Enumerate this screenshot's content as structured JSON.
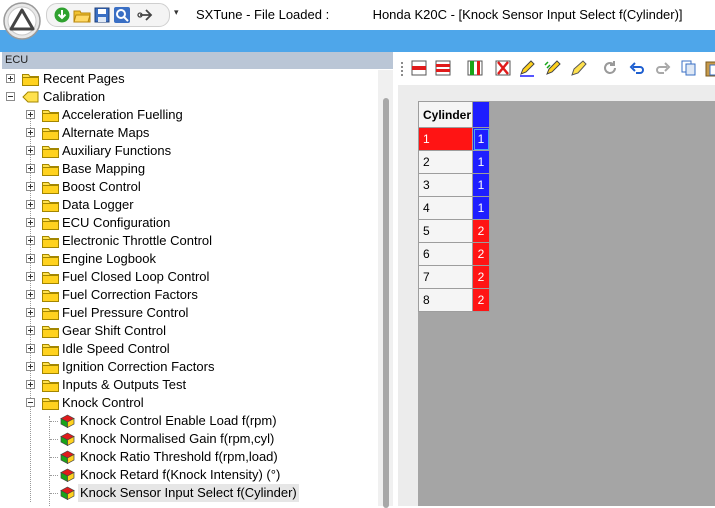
{
  "window": {
    "app_name": "SXTune - File Loaded :",
    "document": "Honda K20C - [Knock Sensor Input Select f(Cylinder)]",
    "quick_access_dropdown": "▾"
  },
  "colors": {
    "accent_band": "#4ea6ea",
    "value_1": "#1e1eff",
    "value_2": "#ff1414",
    "selected_row": "#ff1414"
  },
  "panel": {
    "title": "ECU"
  },
  "tree": {
    "recent": "Recent Pages",
    "calibration": "Calibration",
    "folders": [
      "Acceleration Fuelling",
      "Alternate Maps",
      "Auxiliary Functions",
      "Base Mapping",
      "Boost Control",
      "Data Logger",
      "ECU Configuration",
      "Electronic Throttle Control",
      "Engine Logbook",
      "Fuel Closed Loop Control",
      "Fuel Correction Factors",
      "Fuel Pressure Control",
      "Gear Shift Control",
      "Idle Speed Control",
      "Ignition Correction Factors",
      "Inputs & Outputs Test",
      "Knock Control"
    ],
    "knock_items": [
      "Knock Control Enable Load f(rpm)",
      "Knock Normalised Gain f(rpm,cyl)",
      "Knock Ratio Threshold f(rpm,load)",
      "Knock Retard f(Knock Intensity) (°)",
      "Knock Sensor Input Select f(Cylinder)"
    ],
    "selected_item": "Knock Sensor Input Select f(Cylinder)"
  },
  "table": {
    "header": "Cylinder",
    "rows": [
      {
        "cylinder": "1",
        "value": "1"
      },
      {
        "cylinder": "2",
        "value": "1"
      },
      {
        "cylinder": "3",
        "value": "1"
      },
      {
        "cylinder": "4",
        "value": "1"
      },
      {
        "cylinder": "5",
        "value": "2"
      },
      {
        "cylinder": "6",
        "value": "2"
      },
      {
        "cylinder": "7",
        "value": "2"
      },
      {
        "cylinder": "8",
        "value": "2"
      }
    ],
    "selected_row": "1"
  },
  "toolbar_icons": [
    "add-row-icon",
    "delete-row-icon",
    "add-column-icon",
    "delete-column-icon",
    "edit-cells-icon",
    "multi-edit-icon",
    "pencil-icon",
    "refresh-icon",
    "undo-icon",
    "redo-icon",
    "copy-icon",
    "paste-icon"
  ]
}
